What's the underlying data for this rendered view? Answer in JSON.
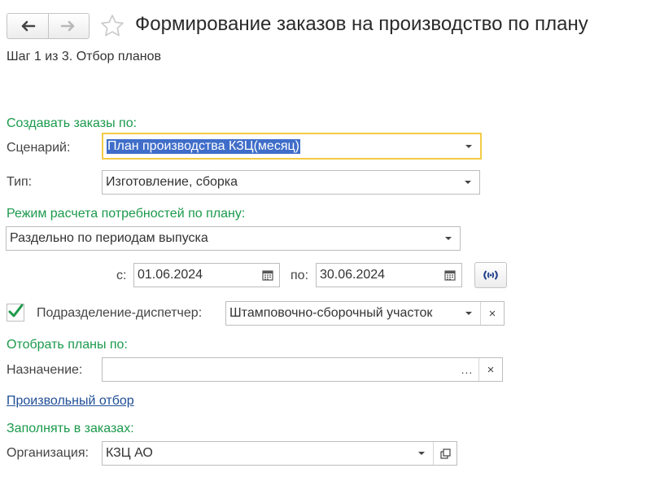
{
  "header": {
    "title": "Формирование заказов на производство по плану",
    "step": "Шаг 1 из 3. Отбор планов"
  },
  "sections": {
    "create_orders": "Создавать заказы по:",
    "calc_mode": "Режим расчета потребностей по плану:",
    "select_plans": "Отобрать планы по:",
    "fill_orders": "Заполнять в заказах:"
  },
  "scenario": {
    "label": "Сценарий:",
    "value": "План производства КЗЦ(месяц)"
  },
  "type": {
    "label": "Тип:",
    "value": "Изготовление, сборка"
  },
  "calc_mode": {
    "value": "Раздельно по периодам выпуска"
  },
  "period": {
    "from_label": "с:",
    "from_value": "01.06.2024",
    "to_label": "по:",
    "to_value": "30.06.2024"
  },
  "dispatcher": {
    "checked": true,
    "label": "Подразделение-диспетчер:",
    "value": "Штамповочно-сборочный участок"
  },
  "purpose": {
    "label": "Назначение:",
    "value": "",
    "dots": "..."
  },
  "custom_filter": {
    "label": "Произвольный отбор"
  },
  "organization": {
    "label": "Организация:",
    "value": "КЗЦ АО"
  },
  "icons": {
    "clear": "×"
  },
  "colors": {
    "section": "#1b9a4c",
    "focus": "#f3cb45",
    "selection": "#3f6dc9",
    "link": "#1f4e96"
  }
}
